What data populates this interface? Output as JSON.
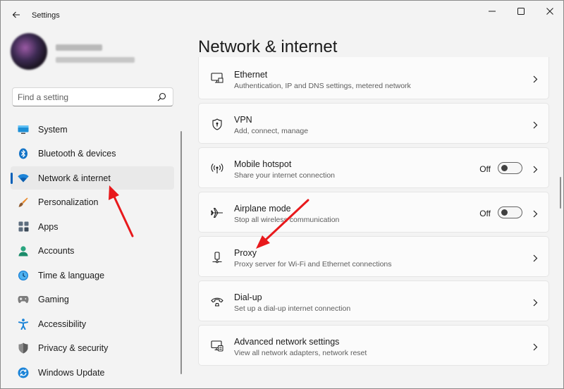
{
  "window": {
    "title": "Settings"
  },
  "search": {
    "placeholder": "Find a setting"
  },
  "sidebar": {
    "items": [
      {
        "label": "System",
        "icon": "system-icon",
        "active": false
      },
      {
        "label": "Bluetooth & devices",
        "icon": "bluetooth-icon",
        "active": false
      },
      {
        "label": "Network & internet",
        "icon": "wifi-icon",
        "active": true
      },
      {
        "label": "Personalization",
        "icon": "brush-icon",
        "active": false
      },
      {
        "label": "Apps",
        "icon": "apps-icon",
        "active": false
      },
      {
        "label": "Accounts",
        "icon": "person-icon",
        "active": false
      },
      {
        "label": "Time & language",
        "icon": "globe-clock-icon",
        "active": false
      },
      {
        "label": "Gaming",
        "icon": "gamepad-icon",
        "active": false
      },
      {
        "label": "Accessibility",
        "icon": "accessibility-icon",
        "active": false
      },
      {
        "label": "Privacy & security",
        "icon": "shield-icon",
        "active": false
      },
      {
        "label": "Windows Update",
        "icon": "update-icon",
        "active": false
      }
    ]
  },
  "main": {
    "title": "Network & internet",
    "cards": [
      {
        "title": "Ethernet",
        "subtitle": "Authentication, IP and DNS settings, metered network",
        "icon": "ethernet-icon"
      },
      {
        "title": "VPN",
        "subtitle": "Add, connect, manage",
        "icon": "vpn-shield-icon"
      },
      {
        "title": "Mobile hotspot",
        "subtitle": "Share your internet connection",
        "icon": "hotspot-icon",
        "toggle": "Off"
      },
      {
        "title": "Airplane mode",
        "subtitle": "Stop all wireless communication",
        "icon": "airplane-icon",
        "toggle": "Off"
      },
      {
        "title": "Proxy",
        "subtitle": "Proxy server for Wi-Fi and Ethernet connections",
        "icon": "proxy-icon"
      },
      {
        "title": "Dial-up",
        "subtitle": "Set up a dial-up internet connection",
        "icon": "dialup-icon"
      },
      {
        "title": "Advanced network settings",
        "subtitle": "View all network adapters, network reset",
        "icon": "advanced-network-icon"
      }
    ]
  },
  "colors": {
    "accent": "#005fb8",
    "annotation": "#e8191c",
    "background": "#f3f3f3",
    "card": "#fbfbfb"
  }
}
